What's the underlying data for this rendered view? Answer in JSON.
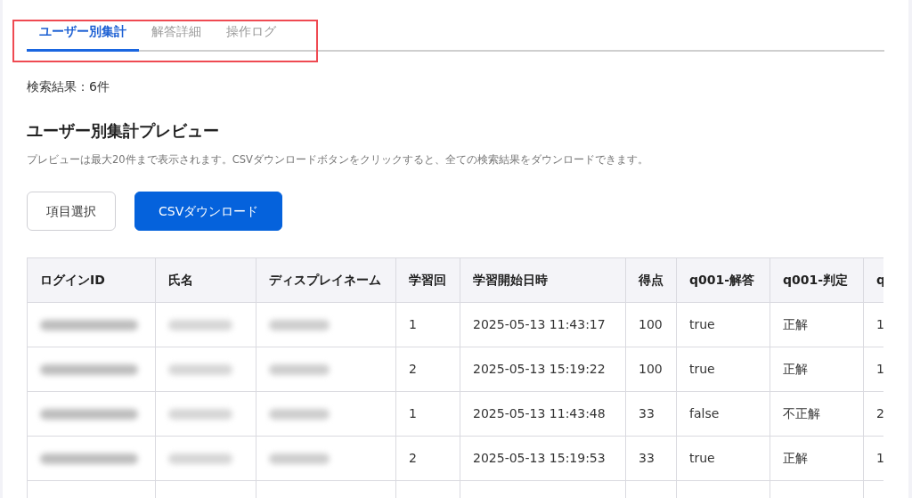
{
  "tabs": [
    {
      "label": "ユーザー別集計",
      "selected": true
    },
    {
      "label": "解答詳細",
      "selected": false
    },
    {
      "label": "操作ログ",
      "selected": false
    }
  ],
  "result_count": "検索結果：6件",
  "preview": {
    "title": "ユーザー別集計プレビュー",
    "description": "プレビューは最大20件まで表示されます。CSVダウンロードボタンをクリックすると、全ての検索結果をダウンロードできます。",
    "buttons": [
      {
        "label": "項目選択",
        "kind": "outline"
      },
      {
        "label": "CSVダウンロード",
        "kind": "primary"
      }
    ]
  },
  "table": {
    "columns": [
      "ログインID",
      "氏名",
      "ディスプレイネーム",
      "学習回",
      "学習開始日時",
      "得点",
      "q001-解答",
      "q001-判定",
      "q"
    ],
    "rows": [
      {
        "cells": [
          {
            "kind": "blurred"
          },
          {
            "kind": "blurred"
          },
          {
            "kind": "blurred"
          },
          {
            "kind": "text",
            "text": "1"
          },
          {
            "kind": "text",
            "text": "2025-05-13 11:43:17"
          },
          {
            "kind": "text",
            "text": "100"
          },
          {
            "kind": "text",
            "text": "true"
          },
          {
            "kind": "text",
            "text": "正解"
          },
          {
            "kind": "text",
            "text": "1"
          }
        ]
      },
      {
        "cells": [
          {
            "kind": "blurred"
          },
          {
            "kind": "blurred"
          },
          {
            "kind": "blurred"
          },
          {
            "kind": "text",
            "text": "2"
          },
          {
            "kind": "text",
            "text": "2025-05-13 15:19:22"
          },
          {
            "kind": "text",
            "text": "100"
          },
          {
            "kind": "text",
            "text": "true"
          },
          {
            "kind": "text",
            "text": "正解"
          },
          {
            "kind": "text",
            "text": "1"
          }
        ]
      },
      {
        "cells": [
          {
            "kind": "blurred"
          },
          {
            "kind": "blurred"
          },
          {
            "kind": "blurred"
          },
          {
            "kind": "text",
            "text": "1"
          },
          {
            "kind": "text",
            "text": "2025-05-13 11:43:48"
          },
          {
            "kind": "text",
            "text": "33"
          },
          {
            "kind": "text",
            "text": "false"
          },
          {
            "kind": "text",
            "text": "不正解"
          },
          {
            "kind": "text",
            "text": "2"
          }
        ]
      },
      {
        "cells": [
          {
            "kind": "blurred"
          },
          {
            "kind": "blurred"
          },
          {
            "kind": "blurred"
          },
          {
            "kind": "text",
            "text": "2"
          },
          {
            "kind": "text",
            "text": "2025-05-13 15:19:53"
          },
          {
            "kind": "text",
            "text": "33"
          },
          {
            "kind": "text",
            "text": "true"
          },
          {
            "kind": "text",
            "text": "正解"
          },
          {
            "kind": "text",
            "text": "1"
          }
        ]
      }
    ]
  }
}
